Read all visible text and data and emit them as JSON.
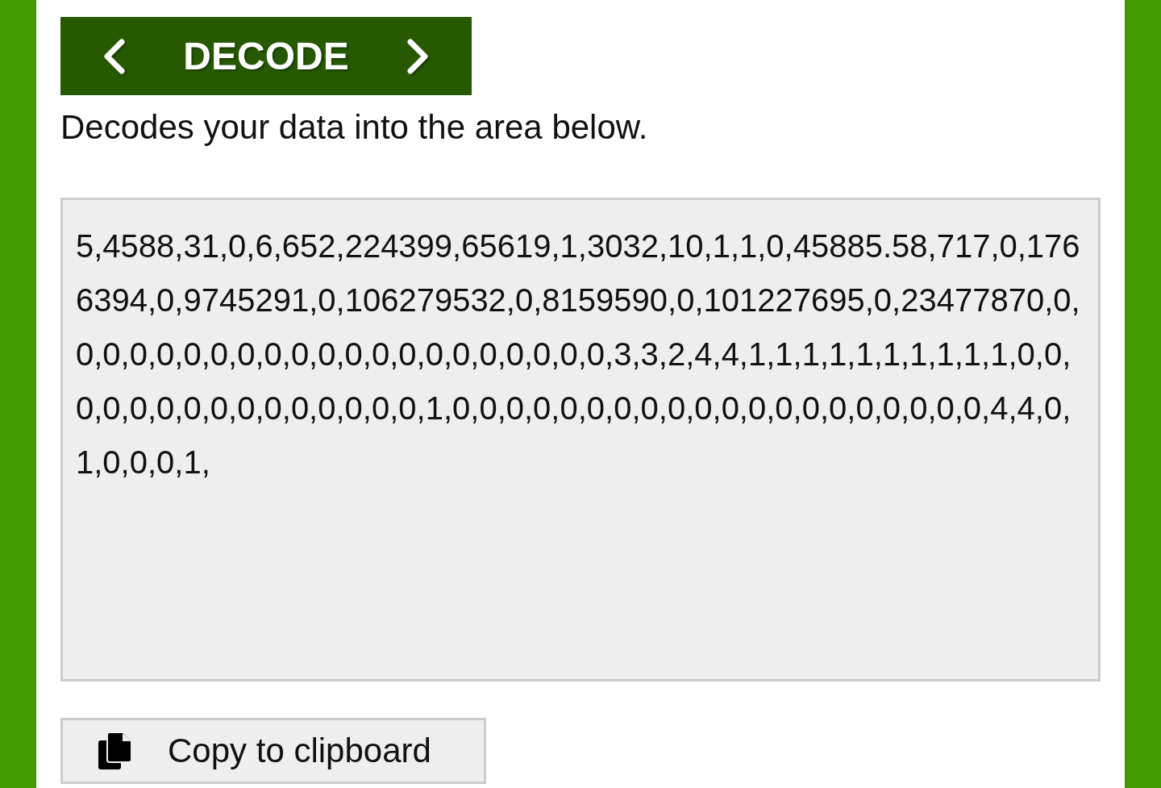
{
  "header": {
    "title": "DECODE"
  },
  "description": "Decodes your data into the area below.",
  "output": {
    "value": "5,4588,31,0,6,652,224399,65619,1,3032,10,1,1,0,45885.58,717,0,1766394,0,9745291,0,106279532,0,8159590,0,101227695,0,23477870,0,0,0,0,0,0,0,0,0,0,0,0,0,0,0,0,0,0,0,0,0,3,3,2,4,4,1,1,1,1,1,1,1,1,1,1,0,0,0,0,0,0,0,0,0,0,0,0,0,0,0,1,0,0,0,0,0,0,0,0,0,0,0,0,0,0,0,0,0,0,0,0,4,4,0,1,0,0,0,1,"
  },
  "copy_button": {
    "label": "Copy to clipboard"
  }
}
